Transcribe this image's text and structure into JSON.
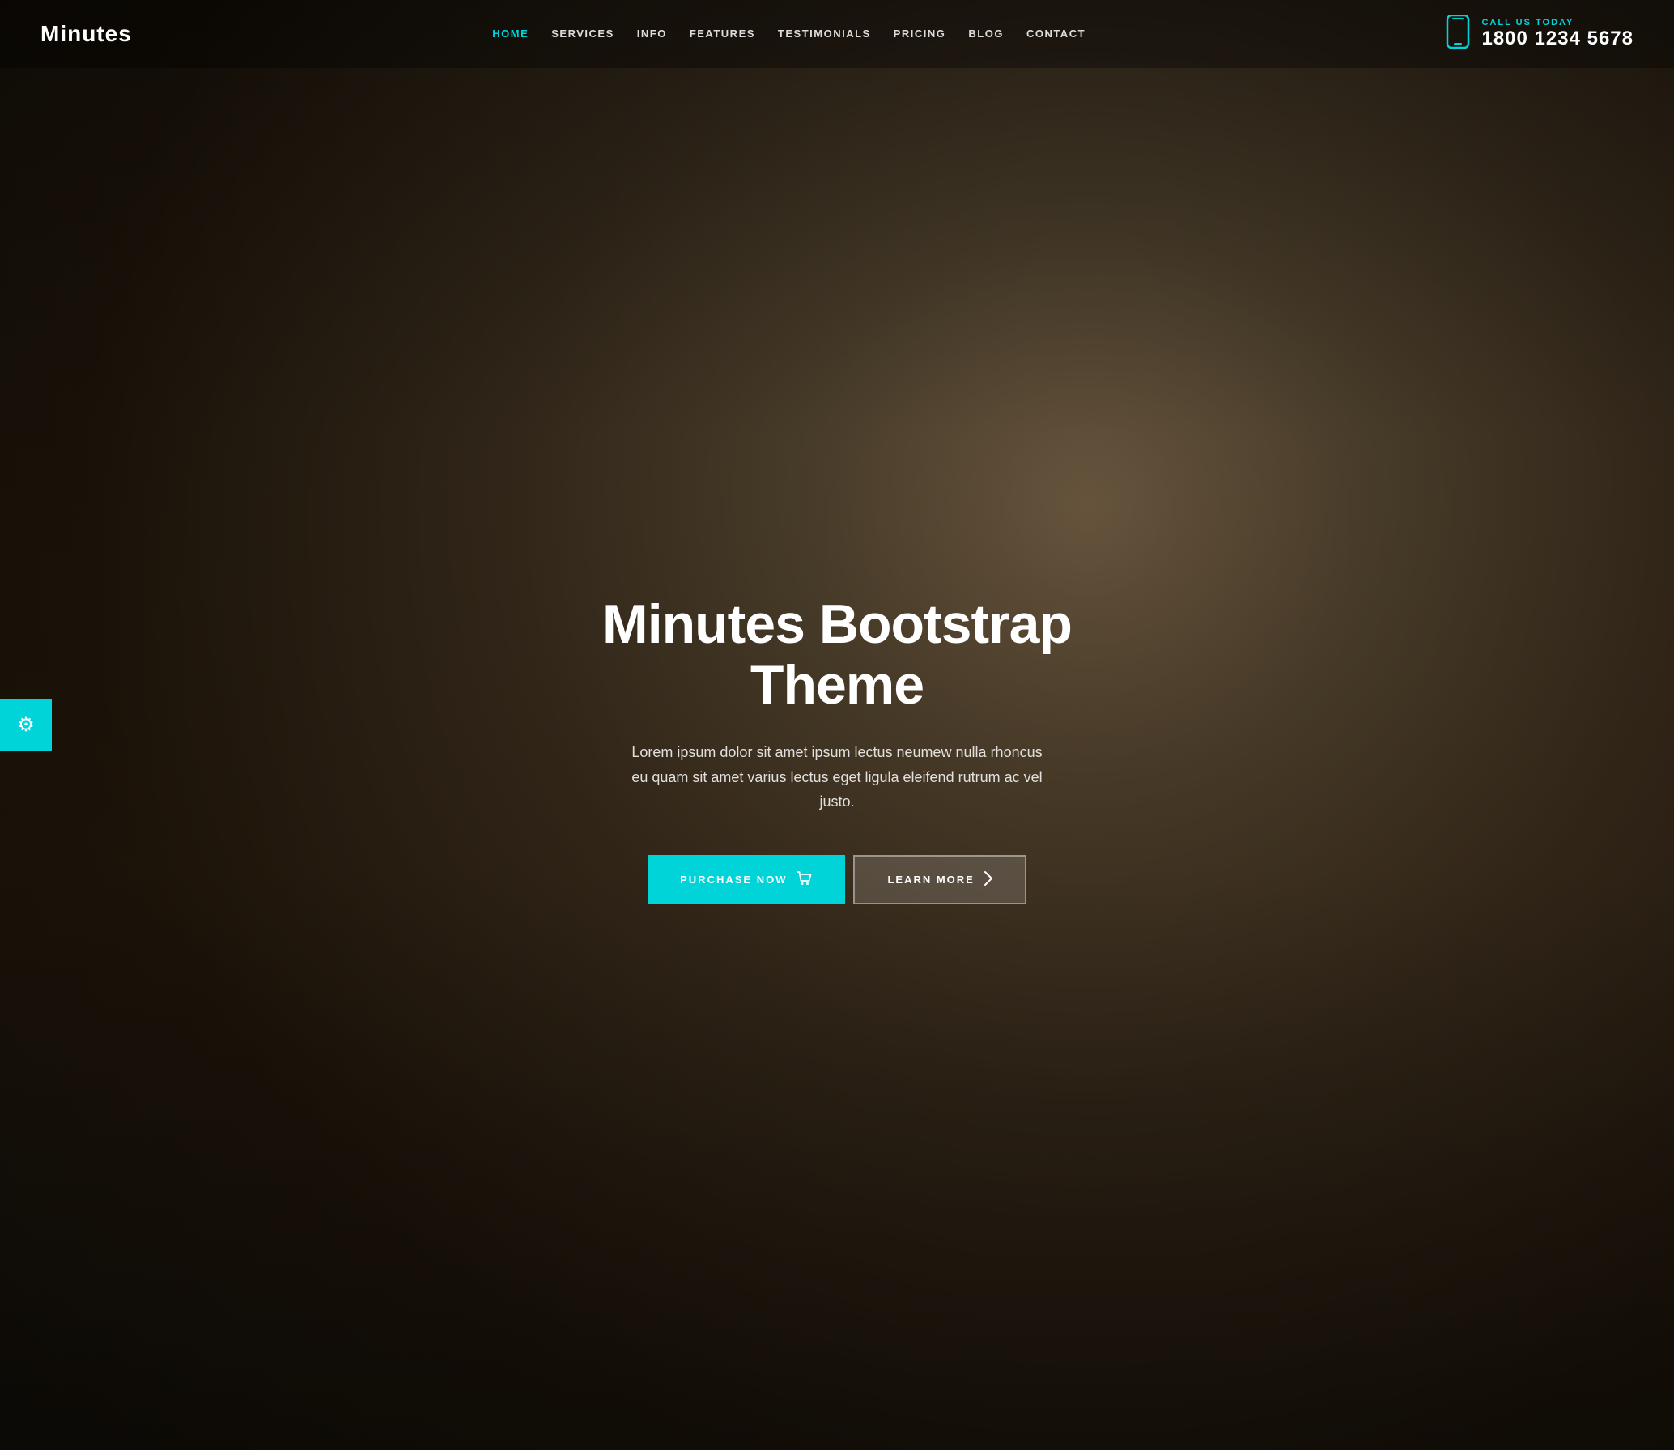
{
  "site": {
    "logo": "Minutes"
  },
  "header": {
    "nav": [
      {
        "label": "HOME",
        "active": true,
        "id": "home"
      },
      {
        "label": "SERVICES",
        "active": false,
        "id": "services"
      },
      {
        "label": "INFO",
        "active": false,
        "id": "info"
      },
      {
        "label": "FEATURES",
        "active": false,
        "id": "features"
      },
      {
        "label": "TESTIMONIALS",
        "active": false,
        "id": "testimonials"
      },
      {
        "label": "PRICING",
        "active": false,
        "id": "pricing"
      },
      {
        "label": "BLOG",
        "active": false,
        "id": "blog"
      },
      {
        "label": "CONTACT",
        "active": false,
        "id": "contact"
      }
    ],
    "cta": {
      "call_label": "CALL US TODAY",
      "phone": "1800 1234 5678"
    }
  },
  "hero": {
    "title": "Minutes Bootstrap Theme",
    "subtitle": "Lorem ipsum dolor sit amet ipsum lectus neumew nulla rhoncus eu quam sit amet varius lectus eget ligula eleifend rutrum ac vel justo.",
    "button_purchase": "PURCHASE NOW",
    "button_learn": "LEARN MORE"
  },
  "gear_button": {
    "icon": "⚙"
  },
  "colors": {
    "accent": "#00d4d8",
    "bg_dark": "#1a1a1a",
    "text_white": "#ffffff"
  }
}
